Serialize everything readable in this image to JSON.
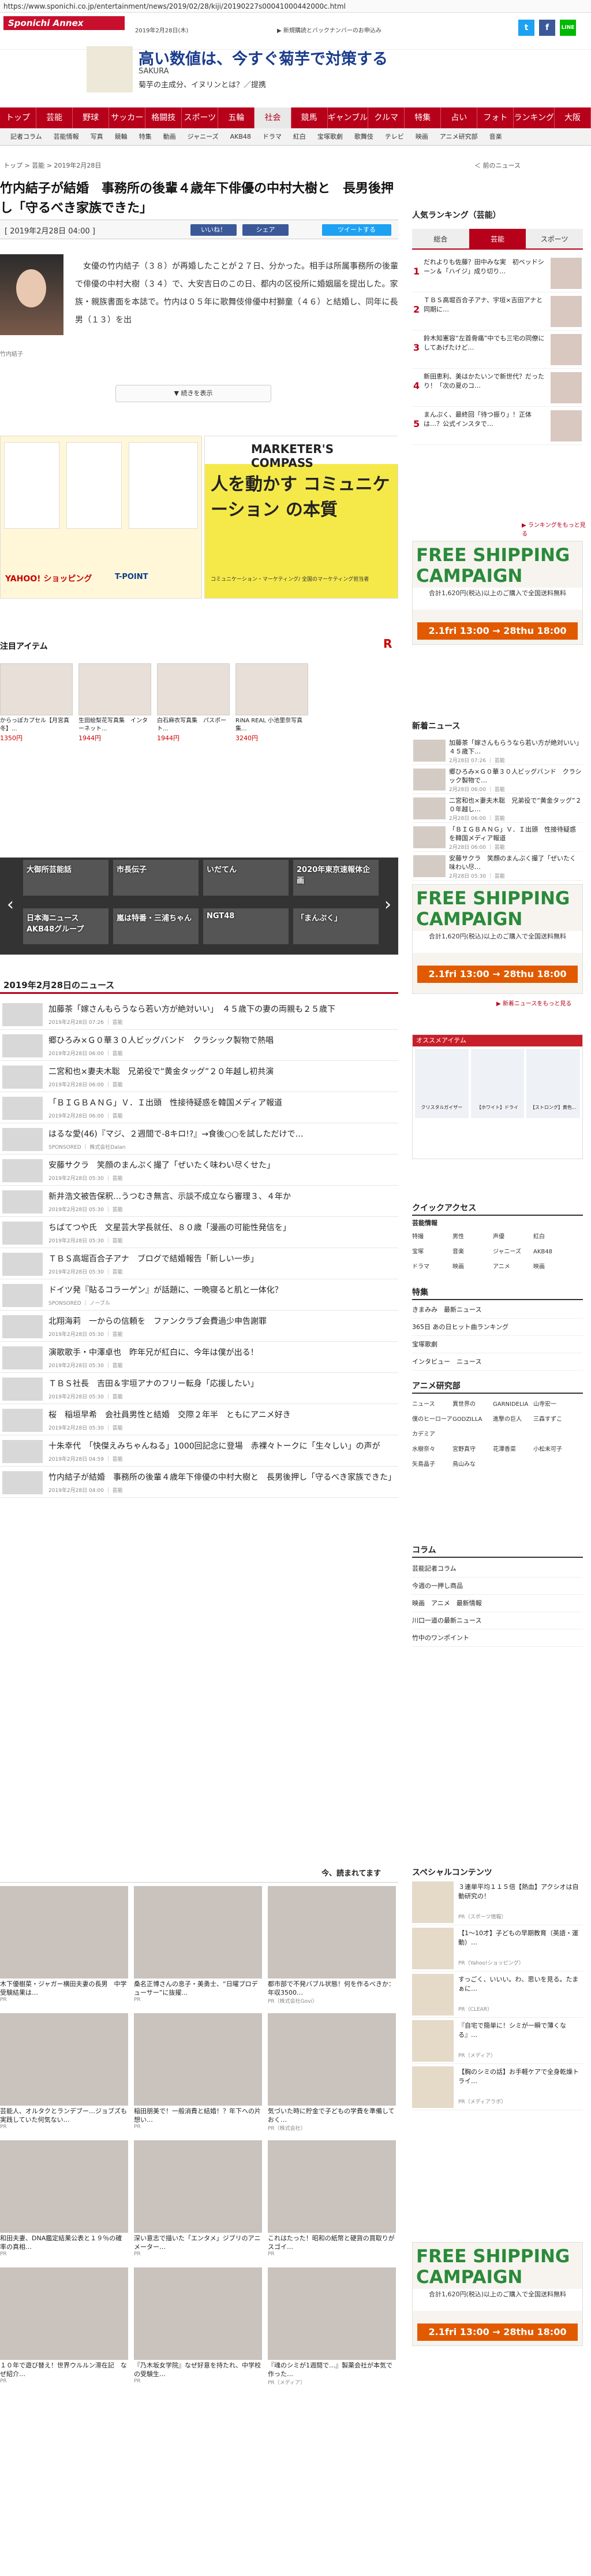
{
  "url": "https://www.sponichi.co.jp/entertainment/news/2019/02/28/kiji/20190227s00041000442000c.html",
  "header": {
    "logo": "Sponichi Annex",
    "date": "2019年2月28日(木)",
    "toplinks": "▶ 新規購読とバックナンバーのお申込み",
    "social": [
      "t",
      "f",
      "LINE"
    ]
  },
  "ad_banner": {
    "headline": "高い数値は、今すぐ菊芋で対策する",
    "sub1": "SAKURA",
    "sub2": "菊芋の主成分、イヌリンとは？／提携"
  },
  "nav": [
    "トップ",
    "芸能",
    "野球",
    "サッカー",
    "格闘技",
    "スポーツ",
    "五輪",
    "社会",
    "競馬",
    "ギャンブル",
    "クルマ",
    "特集",
    "占い",
    "フォト",
    "ランキング",
    "大阪"
  ],
  "nav_active": 7,
  "subnav": [
    "記者コラム",
    "芸能情報",
    "写真",
    "競輪",
    "特集",
    "動画",
    "ジャニーズ",
    "AKB48",
    "ドラマ",
    "紅白",
    "宝塚歌劇",
    "歌舞伎",
    "テレビ",
    "映画",
    "アニメ研究部",
    "音楽"
  ],
  "breadcrumb": "トップ > 芸能 > 2019年2月28日",
  "prevnext": "＜ 前のニュース",
  "article": {
    "title": "竹内結子が結婚　事務所の後輩４歳年下俳優の中村大樹と　長男後押し「守るべき家族できた」",
    "date": "[ 2019年2月28日 04:00 ]",
    "btn_like": "いいね！",
    "btn_share": "シェア",
    "btn_tweet": "ツイートする",
    "photo_caption": "竹内結子",
    "body": "　女優の竹内結子（３８）が再婚したことが２７日、分かった。相手は所属事務所の後輩で俳優の中村大樹（３４）で、大安吉日のこの日、都内の区役所に婚姻届を提出した。家族・親族書面を本誌で。竹内は０５年に歌舞伎俳優中村獅童（４６）と結婚し、同年に長男（１３）を出",
    "more_button": "▼ 続きを表示"
  },
  "ads": {
    "left_brand": "YAHOO! ショッピング",
    "left_tag": "T-POINT",
    "right_brand": "MARKETER'S COMPASS",
    "right_headline": "人を動かす コミュニケーション の本質",
    "right_note": "コミュニケーション・マーケティング/ 全国のマーケティング担当者"
  },
  "items_title": "注目アイテム",
  "items": [
    {
      "name": "からっぽカプセル【月宮真冬】...",
      "price": "1350円"
    },
    {
      "name": "生田絵梨花写真集　インターネット...",
      "price": "1944円"
    },
    {
      "name": "白石麻衣写真集　パスポート...",
      "price": "1944円"
    },
    {
      "name": "RiNA REAL 小池里奈写真集...",
      "price": "3240円"
    }
  ],
  "carousel": [
    "大御所芸能話",
    "市長伝子",
    "いだてん",
    "2020年東京速報体企画",
    "日本海ニュース　AKB48グループ",
    "嵐は特番・三浦ちゃん",
    "NGT48",
    "「まんぷく」"
  ],
  "date_heading": "2019年2月28日のニュース",
  "news": [
    {
      "t": "加藤茶「嫁さんもらうなら若い方が絶対いい」　４５歳下の妻の両親も２５歳下",
      "m": "2019年2月28日 07:26 ｜ 芸能"
    },
    {
      "t": "郷ひろみ×Ｇ０華３０人ビッグバンド　クラシック製物で熱唱",
      "m": "2019年2月28日 06:00 ｜ 芸能"
    },
    {
      "t": "二宮和也×妻夫木聡　兄弟役で“黄金タッグ”２０年越し初共演",
      "m": "2019年2月28日 06:00 ｜ 芸能"
    },
    {
      "t": "「ＢＩＧＢＡＮＧ」Ｖ．Ｉ出頭　性接待疑惑を韓国メディア報道",
      "m": "2019年2月28日 06:00 ｜ 芸能"
    },
    {
      "t": "はるな愛(46)『マジ、２週間で-8キロ!?』→食後○○を試しただけで…",
      "m": "SPONSORED ｜ 株式会社Dalan"
    },
    {
      "t": "安藤サクラ　笑顔のまんぷく撮了「ぜいたく味わい尽くせた」",
      "m": "2019年2月28日 05:30 ｜ 芸能"
    },
    {
      "t": "新井浩文被告保釈…うつむき無言、示談不成立なら審理３、４年か",
      "m": "2019年2月28日 05:30 ｜ 芸能"
    },
    {
      "t": "ちばてつや氏　文星芸大学長就任、８０歳「漫画の可能性発信を」",
      "m": "2019年2月28日 05:30 ｜ 芸能"
    },
    {
      "t": "ＴＢＳ高堀百合子アナ　ブログで結婚報告「新しい一歩」",
      "m": "2019年2月28日 05:30 ｜ 芸能"
    },
    {
      "t": "ドイツ発『貼るコラーゲン』が話題に、一晩寝ると肌と一体化？",
      "m": "SPONSORED ｜ ノーブル"
    },
    {
      "t": "北翔海莉　一からの信頼を　ファンクラブ会費過少申告謝罪",
      "m": "2019年2月28日 05:30 ｜ 芸能"
    },
    {
      "t": "演歌歌手・中澤卓也　昨年兄が紅白に、今年は僕が出る！",
      "m": "2019年2月28日 05:30 ｜ 芸能"
    },
    {
      "t": "ＴＢＳ社長　吉田＆宇垣アナのフリー転身「応援したい」",
      "m": "2019年2月28日 05:30 ｜ 芸能"
    },
    {
      "t": "桜　稲垣早希　会社員男性と結婚　交際２年半　ともにアニメ好き",
      "m": "2019年2月28日 05:30 ｜ 芸能"
    },
    {
      "t": "十朱幸代　「快傑えみちゃんねる」1000回記念に登場　赤裸々トークに「生々しい」の声が",
      "m": "2019年2月28日 04:59 ｜ 芸能"
    },
    {
      "t": "竹内結子が結婚　事務所の後輩４歳年下俳優の中村大樹と　長男後押し「守るべき家族できた」",
      "m": "2019年2月28日 04:00 ｜ 芸能"
    }
  ],
  "reco_title": "今、読まれてます",
  "reco": [
    {
      "t": "木下優樹菜・ジャガー横田夫妻の長男　中学受験結果は…",
      "s": "PR"
    },
    {
      "t": "桑名正博さんの息子・美勇士、“日曜プロデューサー”に抜擢...",
      "s": "PR"
    },
    {
      "t": "都市部で不発バブル状態！何を作るべきか：年収3500…",
      "s": "PR（株式会社Govi）"
    },
    {
      "t": "芸能人、オルタクとランデブー…ジョブズも実践していた何気ない…",
      "s": "PR"
    },
    {
      "t": "稲田朋美で！一般消費と結婚！？年下への片想い…",
      "s": "PR"
    },
    {
      "t": "気づいた時に貯金で子どもの学費を準備しておく…",
      "s": "PR（株式会社）"
    },
    {
      "t": "和田夫妻、DNA鑑定結果公表と１９％の確率の真相…",
      "s": "PR"
    },
    {
      "t": "深い意志で描いた「エンタメ」ジブリのアニメーター…",
      "s": "PR"
    },
    {
      "t": "これはたった！昭和の紙幣と硬貨の買取りがスゴイ…",
      "s": "PR"
    },
    {
      "t": "１０年で遊び替え！世界ウルルン滞在記　なぜ紹介…",
      "s": "PR"
    },
    {
      "t": "『乃木坂女学院』なぜ好意を持たれ、中学校の受験生…",
      "s": "PR"
    },
    {
      "t": "『魂のシミが1週間で…』製薬会社が本気で作った…",
      "s": "PR（メディア）"
    }
  ],
  "side": {
    "rank_title": "人気ランキング（芸能）",
    "tabs": [
      "総合",
      "芸能",
      "スポーツ"
    ],
    "tab_active": 1,
    "rank": [
      "だれよりも佐藤？田中みな実　初ベッドシーン＆「ハイジ」成り切り…",
      "ＴＢＳ高堀百合子アナ、宇垣×吉田アナと同期に…",
      "鈴木知憲容“左首骨痛”中でも三宅の同僚にしてあげたけど…",
      "新田恵利、美はかたいンで新世代？だったり！「次の夏のコ…",
      "まんぷく、最終回「待つ振り」！正体は…？公式インスタで…"
    ],
    "rank_more": "▶ ランキングをもっと見る",
    "ship_title": "FREE SHIPPING CAMPAIGN",
    "ship_sub": "合計1,620円(税込)以上のご購入で全国送料無料",
    "ship_date": "2.1fri 13:00 → 28thu 18:00",
    "new_title": "新着ニュース",
    "new": [
      {
        "t": "加藤茶「嫁さんもらうなら若い方が絶対いい」　４５歳下…",
        "m": "2月28日 07:26 ｜ 芸能"
      },
      {
        "t": "郷ひろみ×Ｇ０華３０人ビッグバンド　クラシック製物で…",
        "m": "2月28日 06:00 ｜ 芸能"
      },
      {
        "t": "二宮和也×妻夫木聡　兄弟役で“黄金タッグ”２０年越し…",
        "m": "2月28日 06:00 ｜ 芸能"
      },
      {
        "t": "「ＢＩＧＢＡＮＧ」Ｖ．Ｉ出頭　性接待疑惑を韓国メディア報道",
        "m": "2月28日 06:00 ｜ 芸能"
      },
      {
        "t": "安藤サクラ　笑顔のまんぷく撮了「ぜいたく味わい尽…",
        "m": "2月28日 05:30 ｜ 芸能"
      }
    ],
    "new_more": "▶ 新着ニュースをもっと見る",
    "osusume": "オススメアイテム",
    "osusume_items": [
      "クリスタルガイザー",
      "【ホワイト】ドライ",
      "【ストロング】黄色..."
    ],
    "quick_title": "クイックアクセス",
    "quick_head": "芸能情報",
    "quick": [
      "特撮",
      "男性",
      "声優",
      "紅白",
      "宝塚",
      "音楽",
      "ジャニーズ",
      "AKB48",
      "ドラマ",
      "映画",
      "アニメ",
      "映画"
    ],
    "feature_title": "特集",
    "features": [
      "きまみみ　最新ニュース",
      "365日 あの日ヒット曲ランキング",
      "宝塚歌劇",
      "インタビュー　ニュース"
    ],
    "anime_title": "アニメ研究部",
    "anime": [
      "ニュース",
      "異世界の",
      "GARNIDELIA",
      "山寺宏一",
      "僕のヒーローアカデミア",
      "GODZILLA",
      "進撃の巨人",
      "三森すずこ",
      "水樹奈々",
      "宮野真守",
      "花澤香菜",
      "小松未可子",
      "矢島晶子",
      "鳥山みな"
    ],
    "column_title": "コラム",
    "columns": [
      "芸能記者コラム",
      "今週の一押し商品",
      "映画　アニメ　最新情報",
      "川口一道の最新ニュース",
      "竹中のワンポイント"
    ],
    "sp_title": "スペシャルコンテンツ",
    "sp": [
      {
        "t": "３連単平均１１５倍【熱血】アクシオは自動研究の！",
        "m": "PR（スポーツ情報）"
      },
      {
        "t": "【1〜10才】子どもの早期教育（英語・運動）…",
        "m": "PR（Yahoo!ショッピング）"
      },
      {
        "t": "すっごく、いいい。わ、思いを見る。たまぁに…",
        "m": "PR（CLEAR）"
      },
      {
        "t": "『自宅で簡単に！シミが一瞬で薄くなる』…",
        "m": "PR（メディア）"
      },
      {
        "t": "【胸のシミの話】お手軽ケアで全身乾燥トライ…",
        "m": "PR（メディアラボ）"
      }
    ]
  },
  "colors": {
    "brand_red": "#b7001a",
    "twitter": "#1da1f2",
    "facebook": "#3b5998",
    "line": "#00b900",
    "campaign_green": "#2a8a3a",
    "campaign_orange": "#e15a00"
  }
}
